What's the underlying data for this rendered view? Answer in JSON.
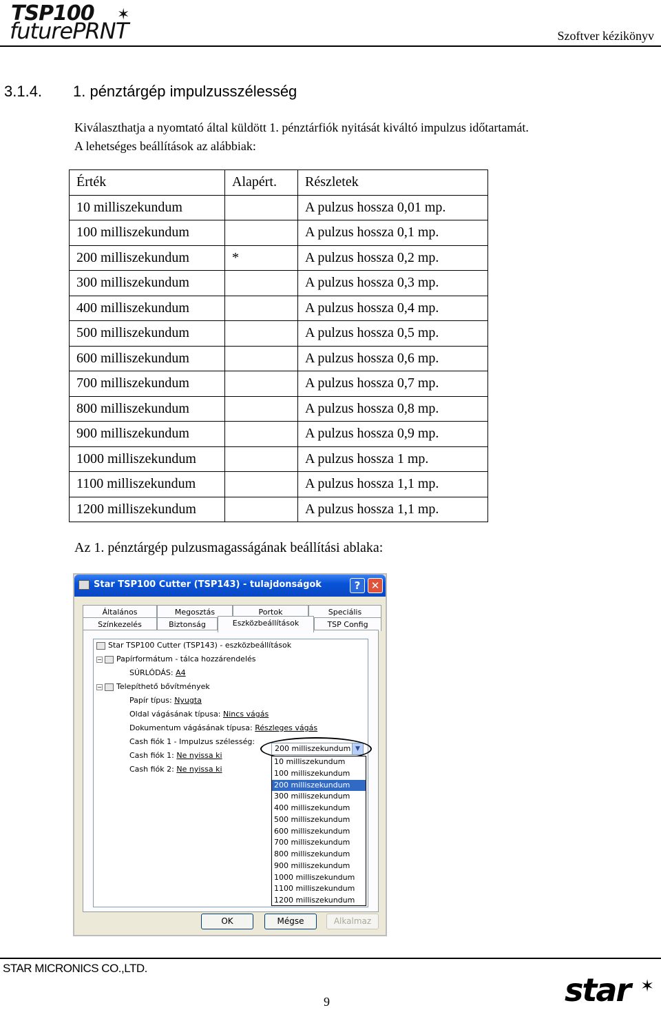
{
  "header": {
    "logo_line1": "TSP100",
    "logo_line2": "futurePRNT",
    "manual_title": "Szoftver kézikönyv"
  },
  "section": {
    "number": "3.1.4.",
    "title": "1. pénztárgép impulzusszélesség"
  },
  "intro": {
    "line1": "Kiválaszthatja a nyomtató által küldött 1. pénztárfiók nyitását kiváltó impulzus időtartamát.",
    "line2": "A lehetséges beállítások az alábbiak:"
  },
  "table": {
    "headers": [
      "Érték",
      "Alapért.",
      "Részletek"
    ],
    "rows": [
      [
        "10 milliszekundum",
        "",
        "A pulzus hossza 0,01 mp."
      ],
      [
        "100 milliszekundum",
        "",
        "A pulzus hossza 0,1 mp."
      ],
      [
        "200 milliszekundum",
        "*",
        "A pulzus hossza 0,2 mp."
      ],
      [
        "300 milliszekundum",
        "",
        "A pulzus hossza 0,3 mp."
      ],
      [
        "400 milliszekundum",
        "",
        "A pulzus hossza 0,4 mp."
      ],
      [
        "500 milliszekundum",
        "",
        "A pulzus hossza 0,5 mp."
      ],
      [
        "600 milliszekundum",
        "",
        "A pulzus hossza 0,6 mp."
      ],
      [
        "700 milliszekundum",
        "",
        "A pulzus hossza 0,7 mp."
      ],
      [
        "800 milliszekundum",
        "",
        "A pulzus hossza 0,8 mp."
      ],
      [
        "900 milliszekundum",
        "",
        "A pulzus hossza 0,9 mp."
      ],
      [
        "1000 milliszekundum",
        "",
        "A pulzus hossza 1 mp."
      ],
      [
        "1100 milliszekundum",
        "",
        "A pulzus hossza 1,1 mp."
      ],
      [
        "1200 milliszekundum",
        "",
        "A pulzus hossza 1,1 mp."
      ]
    ]
  },
  "caption": "Az 1. pénztárgép pulzusmagasságának beállítási ablaka:",
  "dialog": {
    "title": "Star TSP100 Cutter (TSP143) - tulajdonságok",
    "help_label": "?",
    "close_label": "✕",
    "tabs_row1": [
      "Általános",
      "Megosztás",
      "Portok",
      "Speciális"
    ],
    "tabs_row2": [
      "Színkezelés",
      "Biztonság",
      "Eszközbeállítások",
      "TSP Config"
    ],
    "tree": {
      "root": "Star TSP100 Cutter (TSP143) - eszközbeállítások",
      "paper_format": "Papírformátum - tálca hozzárendelés",
      "friction_label": "SÚRLÓDÁS:",
      "friction_value": "A4",
      "options": "Telepíthető bővítmények",
      "paper_type_label": "Papír típus:",
      "paper_type_value": "Nyugta",
      "page_cut_label": "Oldal vágásának típusa:",
      "page_cut_value": "Nincs vágás",
      "doc_cut_label": "Dokumentum vágásának típusa:",
      "doc_cut_value": "Részleges vágás",
      "drawer1_label": "Cash fiók 1 - Impulzus szélesség:",
      "drawer1_value": "200 milliszekundum",
      "drawer1_nyissa_label": "Cash fiók 1:",
      "drawer1_nyissa_value": "Ne nyissa ki",
      "drawer2_label": "Cash fiók 2:",
      "drawer2_value": "Ne nyissa ki"
    },
    "combo_value": "200 milliszekundum",
    "dropdown_items": [
      "10 milliszekundum",
      "100 milliszekundum",
      "200 milliszekundum",
      "300 milliszekundum",
      "400 milliszekundum",
      "500 milliszekundum",
      "600 milliszekundum",
      "700 milliszekundum",
      "800 milliszekundum",
      "900 milliszekundum",
      "1000 milliszekundum",
      "1100 milliszekundum",
      "1200 milliszekundum"
    ],
    "dropdown_selected_index": 2,
    "buttons": {
      "ok": "OK",
      "cancel": "Mégse",
      "apply": "Alkalmaz"
    }
  },
  "footer": {
    "company": "STAR MICRONICS CO.,LTD.",
    "page_number": "9",
    "logo": "star"
  }
}
